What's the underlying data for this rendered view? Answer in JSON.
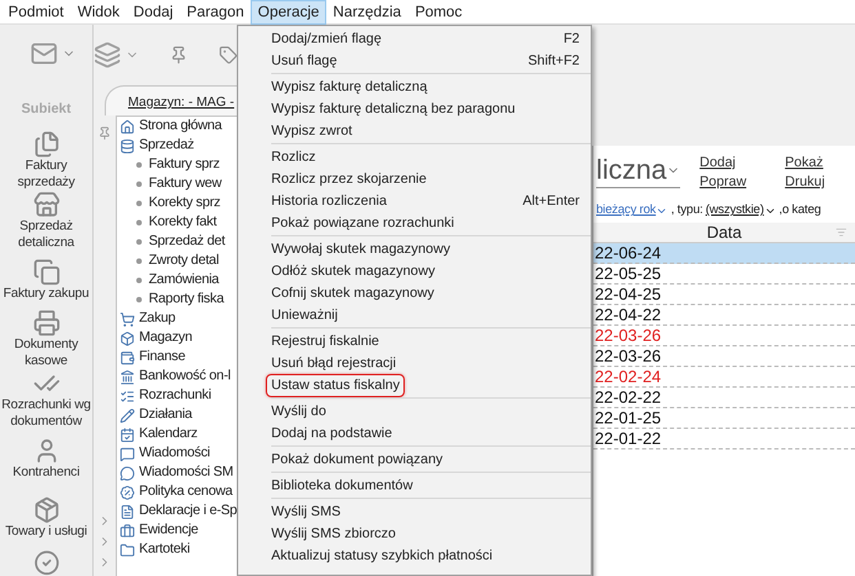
{
  "menubar": [
    {
      "label": "Podmiot",
      "selected": false
    },
    {
      "label": "Widok",
      "selected": false
    },
    {
      "label": "Dodaj",
      "selected": false
    },
    {
      "label": "Paragon",
      "selected": false
    },
    {
      "label": "Operacje",
      "selected": true
    },
    {
      "label": "Narzędzia",
      "selected": false
    },
    {
      "label": "Pomoc",
      "selected": false
    }
  ],
  "logo": "Subiekt",
  "nav": [
    {
      "label": "Faktury sprzedaży"
    },
    {
      "label": "Sprzedaż detaliczna"
    },
    {
      "label": "Faktury zakupu"
    },
    {
      "label": "Dokumenty kasowe"
    },
    {
      "label": "Rozrachunki wg dokumentów"
    },
    {
      "label": "Kontrahenci"
    },
    {
      "label": "Towary i usługi"
    }
  ],
  "tab": "Magazyn: - MAG -",
  "tree": [
    {
      "label": "Strona główna"
    },
    {
      "label": "Sprzedaż",
      "children": [
        {
          "label": "Faktury sprz"
        },
        {
          "label": "Faktury wew"
        },
        {
          "label": "Korekty sprz"
        },
        {
          "label": "Korekty fakt"
        },
        {
          "label": "Sprzedaż det"
        },
        {
          "label": "Zwroty detal"
        },
        {
          "label": "Zamówienia"
        },
        {
          "label": "Raporty fiska"
        }
      ]
    },
    {
      "label": "Zakup"
    },
    {
      "label": "Magazyn"
    },
    {
      "label": "Finanse"
    },
    {
      "label": "Bankowość on-l"
    },
    {
      "label": "Rozrachunki"
    },
    {
      "label": "Działania"
    },
    {
      "label": "Kalendarz"
    },
    {
      "label": "Wiadomości"
    },
    {
      "label": "Wiadomości SM"
    },
    {
      "label": "Polityka cenowa"
    },
    {
      "label": "Deklaracje i e-Sp"
    },
    {
      "label": "Ewidencje"
    },
    {
      "label": "Kartoteki"
    }
  ],
  "menu": [
    [
      {
        "label": "Dodaj/zmień flagę",
        "shortcut": "F2",
        "highlighted": false
      },
      {
        "label": "Usuń flagę",
        "shortcut": "Shift+F2",
        "highlighted": false
      }
    ],
    [
      {
        "label": "Wypisz fakturę detaliczną",
        "highlighted": false
      },
      {
        "label": "Wypisz fakturę detaliczną bez paragonu",
        "highlighted": false
      },
      {
        "label": "Wypisz zwrot",
        "highlighted": false
      }
    ],
    [
      {
        "label": "Rozlicz",
        "highlighted": false
      },
      {
        "label": "Rozlicz przez skojarzenie",
        "highlighted": false
      },
      {
        "label": "Historia rozliczenia",
        "shortcut": "Alt+Enter",
        "highlighted": false
      },
      {
        "label": "Pokaż powiązane rozrachunki",
        "highlighted": false
      }
    ],
    [
      {
        "label": "Wywołaj skutek magazynowy",
        "highlighted": false
      },
      {
        "label": "Odłóż skutek magazynowy",
        "highlighted": false
      },
      {
        "label": "Cofnij skutek magazynowy",
        "highlighted": false
      },
      {
        "label": "Unieważnij",
        "highlighted": false
      }
    ],
    [
      {
        "label": "Rejestruj fiskalnie",
        "highlighted": false
      },
      {
        "label": "Usuń błąd rejestracji",
        "highlighted": false
      },
      {
        "label": "Ustaw status fiskalny",
        "highlighted": true
      }
    ],
    [
      {
        "label": "Wyślij do",
        "highlighted": false
      },
      {
        "label": "Dodaj na podstawie",
        "highlighted": false
      }
    ],
    [
      {
        "label": "Pokaż dokument powiązany",
        "highlighted": false
      }
    ],
    [
      {
        "label": "Biblioteka dokumentów",
        "highlighted": false
      }
    ],
    [
      {
        "label": "Wyślij SMS",
        "highlighted": false
      },
      {
        "label": "Wyślij SMS zbiorczo",
        "highlighted": false
      },
      {
        "label": "Aktualizuj statusy szybkich płatności",
        "highlighted": false
      }
    ]
  ],
  "content": {
    "title": "liczna",
    "actions": [
      [
        "Dodaj",
        "Popraw"
      ],
      [
        "Pokaż",
        "Drukuj"
      ]
    ],
    "filter": {
      "period": "bieżący rok",
      "type_label": ", typu:",
      "type": "(wszystkie)",
      "category_label": ",o kateg"
    },
    "column": "Data",
    "rows": [
      {
        "date": "22-06-24",
        "selected": true,
        "red": false
      },
      {
        "date": "22-05-25",
        "selected": false,
        "red": false
      },
      {
        "date": "22-04-25",
        "selected": false,
        "red": false
      },
      {
        "date": "22-04-22",
        "selected": false,
        "red": false
      },
      {
        "date": "22-03-26",
        "selected": false,
        "red": true
      },
      {
        "date": "22-03-26",
        "selected": false,
        "red": false
      },
      {
        "date": "22-02-24",
        "selected": false,
        "red": true
      },
      {
        "date": "22-02-22",
        "selected": false,
        "red": false
      },
      {
        "date": "22-01-25",
        "selected": false,
        "red": false
      },
      {
        "date": "22-01-22",
        "selected": false,
        "red": false
      }
    ]
  }
}
